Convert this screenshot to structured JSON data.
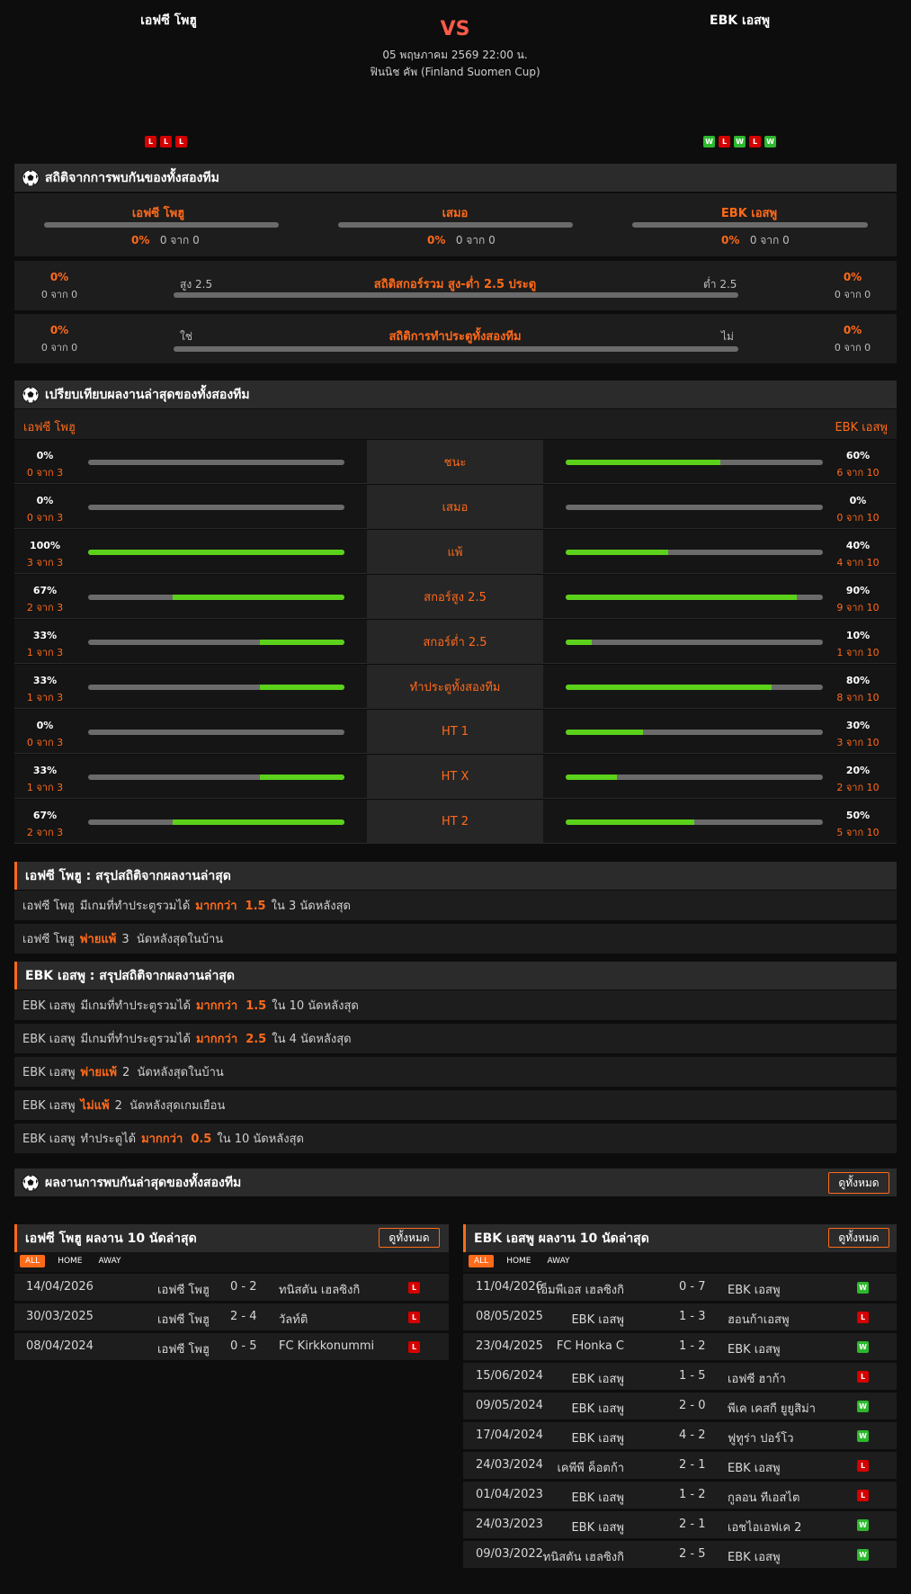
{
  "header": {
    "home_team": "เอฟซี โพฮู",
    "away_team": "EBK เอสพู",
    "vs": "VS",
    "datetime": "05 พฤษภาคม 2569 22:00 น.",
    "competition": "ฟินนิช คัพ (Finland Suomen Cup)",
    "home_form": [
      "L",
      "L",
      "L"
    ],
    "away_form": [
      "W",
      "L",
      "W",
      "L",
      "W"
    ]
  },
  "colors": {
    "accent": "#ff6a1a",
    "win": "#2db82d",
    "loss": "#d50000",
    "bar_fill": "#5bd11a"
  },
  "h2h": {
    "title": "สถิติจากการพบกันของทั้งสองทีม",
    "home_label": "เอฟซี โพฮู",
    "draw_label": "เสมอ",
    "away_label": "EBK เอสพู",
    "home_pct": "0%",
    "home_of": "0 จาก 0",
    "draw_pct": "0%",
    "draw_of": "0 จาก 0",
    "away_pct": "0%",
    "away_of": "0 จาก 0",
    "ou": {
      "title": "สถิติสกอร์รวม สูง-ต่ำ 2.5 ประตู",
      "left_label": "สูง 2.5",
      "right_label": "ต่ำ 2.5",
      "left_pct": "0%",
      "left_of": "0 จาก 0",
      "right_pct": "0%",
      "right_of": "0 จาก 0"
    },
    "btts": {
      "title": "สถิติการทำประตูทั้งสองทีม",
      "left_label": "ใช่",
      "right_label": "ไม่",
      "left_pct": "0%",
      "left_of": "0 จาก 0",
      "right_pct": "0%",
      "right_of": "0 จาก 0"
    }
  },
  "compare": {
    "title": "เปรียบเทียบผลงานล่าสุดของทั้งสองทีม",
    "home_label": "เอฟซี โพฮู",
    "away_label": "EBK เอสพู",
    "rows": [
      {
        "label": "ชนะ",
        "home_pct": "0%",
        "home_of": "0 จาก 3",
        "home_val": 0,
        "away_pct": "60%",
        "away_of": "6 จาก 10",
        "away_val": 60
      },
      {
        "label": "เสมอ",
        "home_pct": "0%",
        "home_of": "0 จาก 3",
        "home_val": 0,
        "away_pct": "0%",
        "away_of": "0 จาก 10",
        "away_val": 0
      },
      {
        "label": "แพ้",
        "home_pct": "100%",
        "home_of": "3 จาก 3",
        "home_val": 100,
        "away_pct": "40%",
        "away_of": "4 จาก 10",
        "away_val": 40
      },
      {
        "label": "สกอร์สูง 2.5",
        "home_pct": "67%",
        "home_of": "2 จาก 3",
        "home_val": 67,
        "away_pct": "90%",
        "away_of": "9 จาก 10",
        "away_val": 90
      },
      {
        "label": "สกอร์ต่ำ 2.5",
        "home_pct": "33%",
        "home_of": "1 จาก 3",
        "home_val": 33,
        "away_pct": "10%",
        "away_of": "1 จาก 10",
        "away_val": 10
      },
      {
        "label": "ทำประตูทั้งสองทีม",
        "home_pct": "33%",
        "home_of": "1 จาก 3",
        "home_val": 33,
        "away_pct": "80%",
        "away_of": "8 จาก 10",
        "away_val": 80
      },
      {
        "label": "HT 1",
        "home_pct": "0%",
        "home_of": "0 จาก 3",
        "home_val": 0,
        "away_pct": "30%",
        "away_of": "3 จาก 10",
        "away_val": 30
      },
      {
        "label": "HT X",
        "home_pct": "33%",
        "home_of": "1 จาก 3",
        "home_val": 33,
        "away_pct": "20%",
        "away_of": "2 จาก 10",
        "away_val": 20
      },
      {
        "label": "HT 2",
        "home_pct": "67%",
        "home_of": "2 จาก 3",
        "home_val": 67,
        "away_pct": "50%",
        "away_of": "5 จาก 10",
        "away_val": 50
      }
    ]
  },
  "home_summary": {
    "title": "เอฟซี โพฮู : สรุปสถิติจากผลงานล่าสุด",
    "rows": [
      {
        "team": "เอฟซี โพฮู",
        "pre": "มีเกมที่ทำประตูรวมได้",
        "hl": "มากกว่า  1.5",
        "post": "ใน 3 นัดหลังสุด"
      },
      {
        "team": "เอฟซี โพฮู",
        "pre": "",
        "hl": "พ่ายแพ้",
        "post": "3  นัดหลังสุดในบ้าน"
      }
    ]
  },
  "away_summary": {
    "title": "EBK เอสพู : สรุปสถิติจากผลงานล่าสุด",
    "rows": [
      {
        "team": "EBK เอสพู",
        "pre": "มีเกมที่ทำประตูรวมได้",
        "hl": "มากกว่า  1.5",
        "post": "ใน 10 นัดหลังสุด"
      },
      {
        "team": "EBK เอสพู",
        "pre": "มีเกมที่ทำประตูรวมได้",
        "hl": "มากกว่า  2.5",
        "post": "ใน 4 นัดหลังสุด"
      },
      {
        "team": "EBK เอสพู",
        "pre": "",
        "hl": "พ่ายแพ้",
        "post": "2  นัดหลังสุดในบ้าน"
      },
      {
        "team": "EBK เอสพู",
        "pre": "",
        "hl": "ไม่แพ้",
        "post": "2  นัดหลังสุดเกมเยือน"
      },
      {
        "team": "EBK เอสพู",
        "pre": "ทำประตูได้",
        "hl": "มากกว่า  0.5",
        "post": "ใน 10 นัดหลังสุด"
      }
    ]
  },
  "h2h_results": {
    "title": "ผลงานการพบกันล่าสุดของทั้งสองทีม",
    "view_all": "ดูทั้งหมด"
  },
  "home_last10": {
    "title": "เอฟซี โพฮู ผลงาน 10 นัดล่าสุด",
    "view_all": "ดูทั้งหมด",
    "tabs": [
      "ALL",
      "HOME",
      "AWAY"
    ],
    "matches": [
      {
        "date": "14/04/2026",
        "home": "เอฟซี โพฮู",
        "score": "0 - 2",
        "away": "ทนิสตัน เฮลซิงกิ",
        "res": "L"
      },
      {
        "date": "30/03/2025",
        "home": "เอฟซี โพฮู",
        "score": "2 - 4",
        "away": "วัลท์ติ",
        "res": "L"
      },
      {
        "date": "08/04/2024",
        "home": "เอฟซี โพฮู",
        "score": "0 - 5",
        "away": "FC Kirkkonummi",
        "res": "L"
      }
    ]
  },
  "away_last10": {
    "title": "EBK เอสพู ผลงาน 10 นัดล่าสุด",
    "view_all": "ดูทั้งหมด",
    "tabs": [
      "ALL",
      "HOME",
      "AWAY"
    ],
    "matches": [
      {
        "date": "11/04/2026",
        "home": "เอ็มพีเอส เฮลซิงกิ",
        "score": "0 - 7",
        "away": "EBK เอสพู",
        "res": "W"
      },
      {
        "date": "08/05/2025",
        "home": "EBK เอสพู",
        "score": "1 - 3",
        "away": "ฮอนก้าเอสพู",
        "res": "L"
      },
      {
        "date": "23/04/2025",
        "home": "FC Honka C",
        "score": "1 - 2",
        "away": "EBK เอสพู",
        "res": "W"
      },
      {
        "date": "15/06/2024",
        "home": "EBK เอสพู",
        "score": "1 - 5",
        "away": "เอฟซี ฮาก้า",
        "res": "L"
      },
      {
        "date": "09/05/2024",
        "home": "EBK เอสพู",
        "score": "2 - 0",
        "away": "พีเค เคสกี ยูยูสิม่า",
        "res": "W"
      },
      {
        "date": "17/04/2024",
        "home": "EBK เอสพู",
        "score": "4 - 2",
        "away": "ฟูทูร่า ปอร์โว",
        "res": "W"
      },
      {
        "date": "24/03/2024",
        "home": "เคพีพี ค็อตก้า",
        "score": "2 - 1",
        "away": "EBK เอสพู",
        "res": "L"
      },
      {
        "date": "01/04/2023",
        "home": "EBK เอสพู",
        "score": "1 - 2",
        "away": "กูลอน ทีเอสไต",
        "res": "L"
      },
      {
        "date": "24/03/2023",
        "home": "EBK เอสพู",
        "score": "2 - 1",
        "away": "เอชไอเอฟเค 2",
        "res": "W"
      },
      {
        "date": "09/03/2022",
        "home": "ทนิสตัน เฮลซิงกิ",
        "score": "2 - 5",
        "away": "EBK เอสพู",
        "res": "W"
      }
    ]
  }
}
